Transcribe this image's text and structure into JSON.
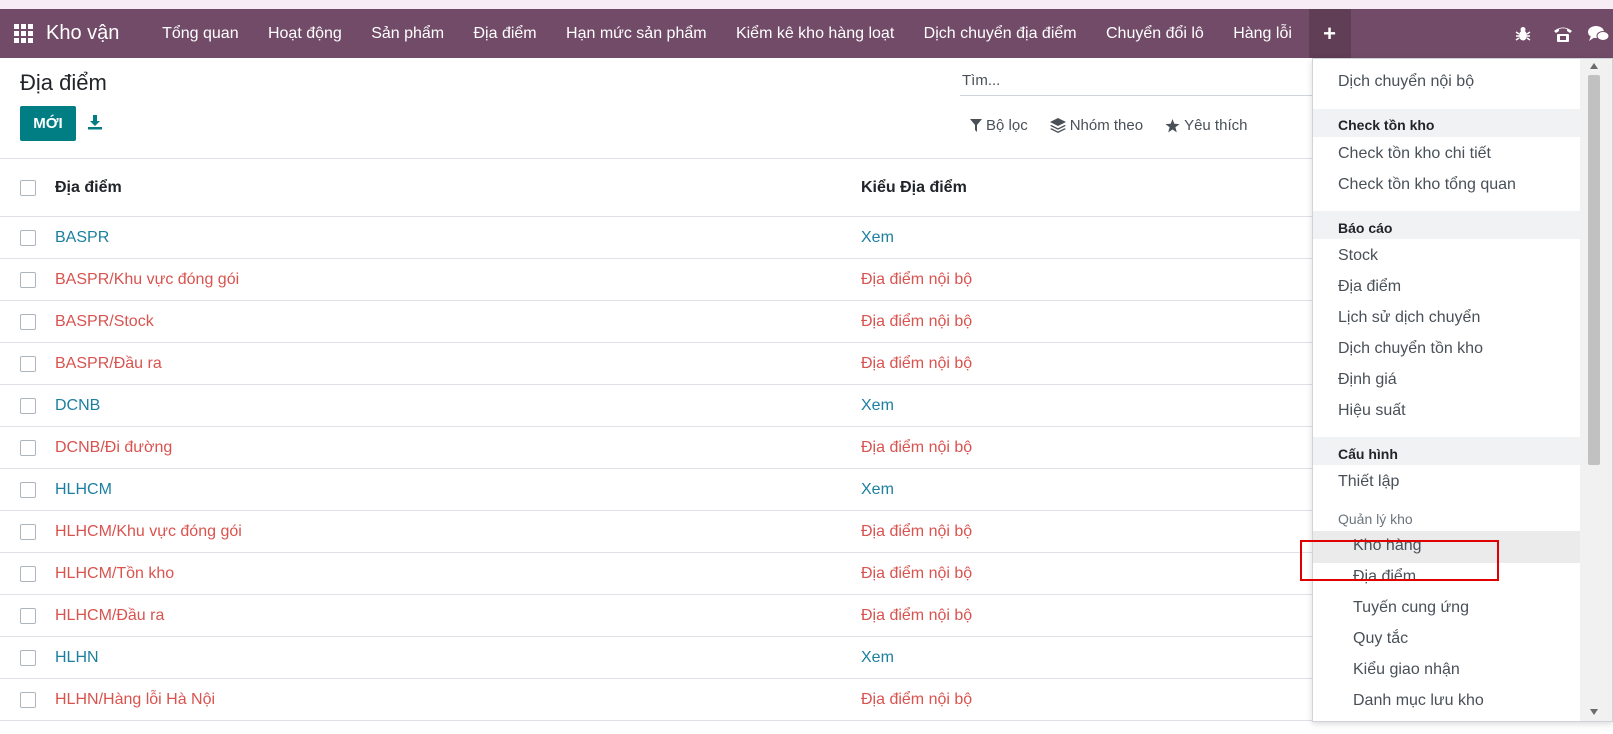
{
  "navbar": {
    "brand": "Kho vận",
    "menu": [
      "Tổng quan",
      "Hoạt động",
      "Sản phẩm",
      "Địa điểm",
      "Hạn mức sản phẩm",
      "Kiểm kê kho hàng loạt",
      "Dịch chuyển địa điểm",
      "Chuyển đổi lô",
      "Hàng lỗi"
    ],
    "plus_label": "+",
    "right_icons": [
      "bug-icon",
      "phone-icon",
      "chat-icon"
    ],
    "bg_color": "#714b67"
  },
  "control_panel": {
    "title": "Địa điểm",
    "new_button": "MỚI",
    "search_placeholder": "Tìm...",
    "filters": {
      "filter": "Bộ lọc",
      "group_by": "Nhóm theo",
      "favorites": "Yêu thích"
    }
  },
  "list": {
    "columns": [
      "Địa điểm",
      "Kiểu Địa điểm"
    ],
    "rows": [
      {
        "name": "BASPR",
        "type": "Xem",
        "style": "blue"
      },
      {
        "name": "BASPR/Khu vực đóng gói",
        "type": "Địa điểm nội bộ",
        "style": "red"
      },
      {
        "name": "BASPR/Stock",
        "type": "Địa điểm nội bộ",
        "style": "red"
      },
      {
        "name": "BASPR/Đầu ra",
        "type": "Địa điểm nội bộ",
        "style": "red"
      },
      {
        "name": "DCNB",
        "type": "Xem",
        "style": "blue"
      },
      {
        "name": "DCNB/Đi đường",
        "type": "Địa điểm nội bộ",
        "style": "red"
      },
      {
        "name": "HLHCM",
        "type": "Xem",
        "style": "blue"
      },
      {
        "name": "HLHCM/Khu vực đóng gói",
        "type": "Địa điểm nội bộ",
        "style": "red"
      },
      {
        "name": "HLHCM/Tồn kho",
        "type": "Địa điểm nội bộ",
        "style": "red"
      },
      {
        "name": "HLHCM/Đầu ra",
        "type": "Địa điểm nội bộ",
        "style": "red"
      },
      {
        "name": "HLHN",
        "type": "Xem",
        "style": "blue"
      },
      {
        "name": "HLHN/Hàng lỗi Hà Nội",
        "type": "Địa điểm nội bộ",
        "style": "red"
      }
    ]
  },
  "dropdown": {
    "top_item": "Dịch chuyển nội bộ",
    "section_check": "Check tồn kho",
    "check_items": [
      "Check tồn kho chi tiết",
      "Check tồn kho tổng quan"
    ],
    "section_report": "Báo cáo",
    "report_items": [
      "Stock",
      "Địa điểm",
      "Lịch sử dịch chuyển",
      "Dịch chuyển tồn kho",
      "Định giá",
      "Hiệu suất"
    ],
    "section_config": "Cấu hình",
    "config_items": [
      "Thiết lập"
    ],
    "group_warehouse": "Quản lý kho",
    "warehouse_items": [
      "Kho hàng",
      "Địa điểm",
      "Tuyến cung ứng",
      "Quy tắc",
      "Kiểu giao nhận",
      "Danh mục lưu kho"
    ]
  }
}
